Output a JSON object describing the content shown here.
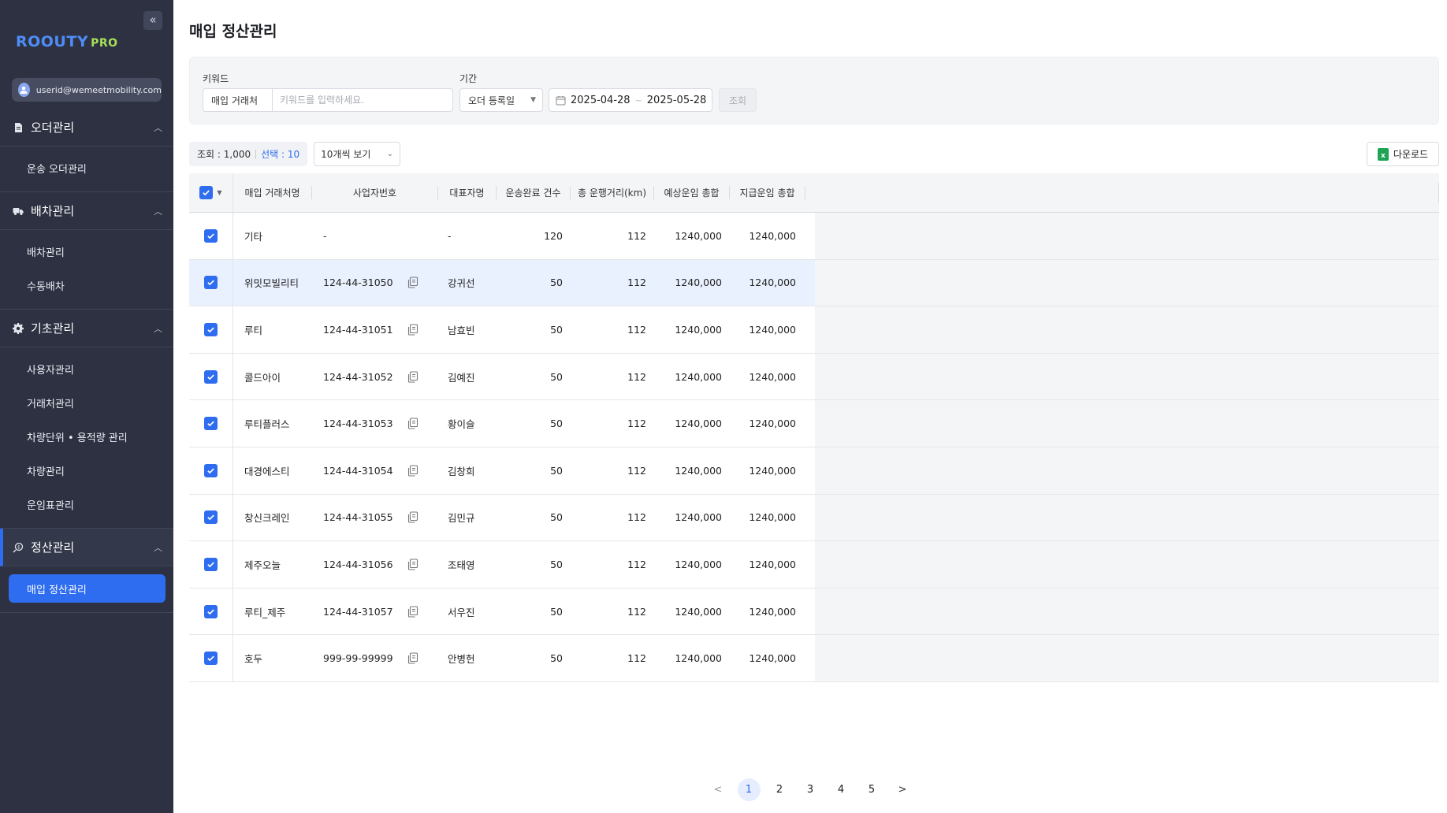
{
  "sidebar": {
    "logo_main": "ROOUTY",
    "logo_sub": "PRO",
    "user_email": "userid@wemeetmobility.com",
    "sections": [
      {
        "label": "오더관리",
        "icon": "document-icon",
        "items": [
          "운송 오더관리"
        ]
      },
      {
        "label": "배차관리",
        "icon": "truck-icon",
        "items": [
          "배차관리",
          "수동배차"
        ]
      },
      {
        "label": "기초관리",
        "icon": "gear-icon",
        "items": [
          "사용자관리",
          "거래처관리",
          "차량단위 • 용적량 관리",
          "차량관리",
          "운임표관리"
        ]
      },
      {
        "label": "정산관리",
        "icon": "settlement-icon",
        "items": [
          "매입 정산관리"
        ]
      }
    ]
  },
  "page": {
    "title": "매입 정산관리"
  },
  "filters": {
    "keyword_label": "키워드",
    "keyword_type": "매입 거래처",
    "keyword_placeholder": "키워드를 입력하세요.",
    "period_label": "기간",
    "period_type": "오더 등록일",
    "date_from": "2025-04-28",
    "date_sep": "~",
    "date_to": "2025-05-28",
    "search_label": "조회"
  },
  "results": {
    "count_label": "조회 : 1,000",
    "selected_label": "선택 : 10",
    "page_size": "10개씩 보기",
    "download_label": "다운로드"
  },
  "table": {
    "columns": [
      "매입 거래처명",
      "사업자번호",
      "대표자명",
      "운송완료 건수",
      "총 운행거리(km)",
      "예상운임 총합",
      "지급운임 총합"
    ],
    "rows": [
      {
        "name": "기타",
        "biz": "-",
        "ceo": "-",
        "done": "120",
        "dist": "112",
        "expected": "1240,000",
        "paid": "1240,000",
        "copy": false
      },
      {
        "name": "위밋모빌리티",
        "biz": "124-44-31050",
        "ceo": "강귀선",
        "done": "50",
        "dist": "112",
        "expected": "1240,000",
        "paid": "1240,000",
        "copy": true
      },
      {
        "name": "루티",
        "biz": "124-44-31051",
        "ceo": "남효빈",
        "done": "50",
        "dist": "112",
        "expected": "1240,000",
        "paid": "1240,000",
        "copy": true
      },
      {
        "name": "콜드아이",
        "biz": "124-44-31052",
        "ceo": "김예진",
        "done": "50",
        "dist": "112",
        "expected": "1240,000",
        "paid": "1240,000",
        "copy": true
      },
      {
        "name": "루티플러스",
        "biz": "124-44-31053",
        "ceo": "황이슬",
        "done": "50",
        "dist": "112",
        "expected": "1240,000",
        "paid": "1240,000",
        "copy": true
      },
      {
        "name": "대경에스티",
        "biz": "124-44-31054",
        "ceo": "김창희",
        "done": "50",
        "dist": "112",
        "expected": "1240,000",
        "paid": "1240,000",
        "copy": true
      },
      {
        "name": "창신크레인",
        "biz": "124-44-31055",
        "ceo": "김민규",
        "done": "50",
        "dist": "112",
        "expected": "1240,000",
        "paid": "1240,000",
        "copy": true
      },
      {
        "name": "제주오늘",
        "biz": "124-44-31056",
        "ceo": "조태영",
        "done": "50",
        "dist": "112",
        "expected": "1240,000",
        "paid": "1240,000",
        "copy": true
      },
      {
        "name": "루티_제주",
        "biz": "124-44-31057",
        "ceo": "서우진",
        "done": "50",
        "dist": "112",
        "expected": "1240,000",
        "paid": "1240,000",
        "copy": true
      },
      {
        "name": "호두",
        "biz": "999-99-99999",
        "ceo": "안병헌",
        "done": "50",
        "dist": "112",
        "expected": "1240,000",
        "paid": "1240,000",
        "copy": true
      }
    ]
  },
  "pagination": {
    "pages": [
      "1",
      "2",
      "3",
      "4",
      "5"
    ],
    "current": "1",
    "prev": "<",
    "next": ">"
  },
  "colors": {
    "sidebar_bg": "#2d3142",
    "accent": "#2f6df0",
    "logo_main": "#4f8df6",
    "logo_sub": "#a6e05a",
    "excel_green": "#1fa355"
  }
}
